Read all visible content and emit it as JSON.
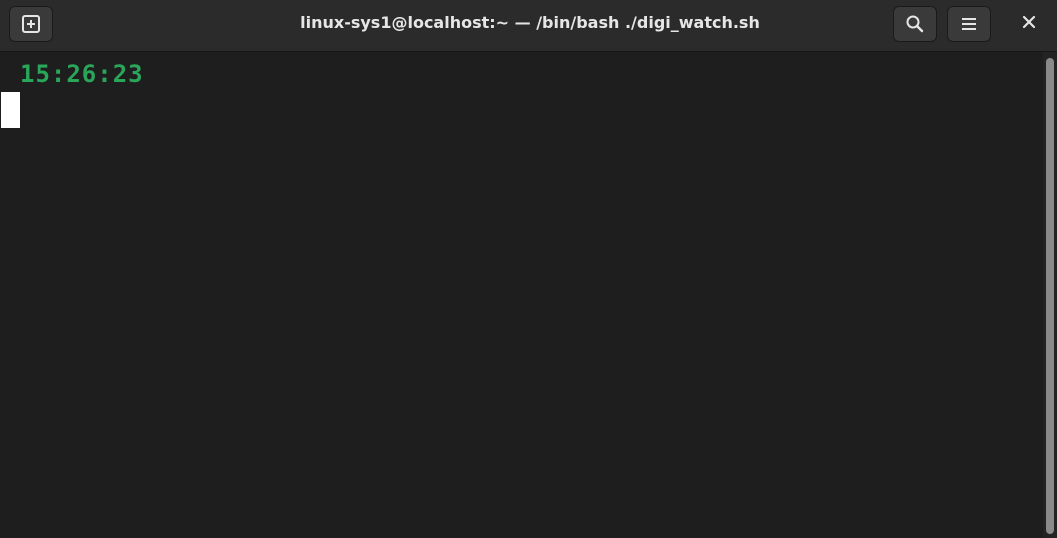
{
  "window": {
    "title": "linux-sys1@localhost:~ — /bin/bash ./digi_watch.sh"
  },
  "titlebar": {
    "new_tab_icon": "new-tab-icon",
    "search_icon": "search-icon",
    "menu_icon": "hamburger-menu-icon",
    "close_icon": "close-icon"
  },
  "terminal": {
    "clock_text": "15:26:23",
    "clock_color": "#2aa65a",
    "background": "#1e1e1e"
  }
}
